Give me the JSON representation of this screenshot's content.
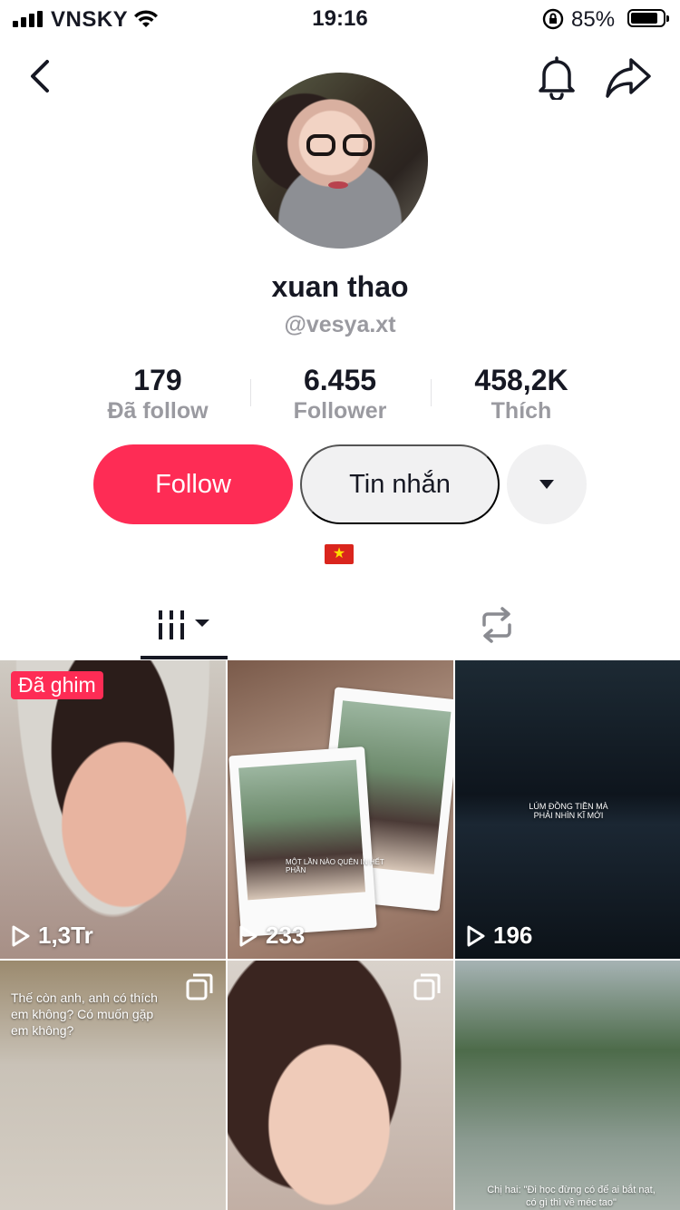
{
  "status_bar": {
    "carrier": "VNSKY",
    "time": "19:16",
    "battery_percent": "85%",
    "battery_level": 0.85
  },
  "header": {
    "back_icon": "chevron-left-icon",
    "notification_icon": "bell-icon",
    "share_icon": "share-arrow-icon"
  },
  "profile": {
    "display_name": "xuan thao",
    "username": "@vesya.xt",
    "stats": [
      {
        "value": "179",
        "label": "Đã follow"
      },
      {
        "value": "6.455",
        "label": "Follower"
      },
      {
        "value": "458,2K",
        "label": "Thích"
      }
    ],
    "bio_flag": "vietnam-flag-icon"
  },
  "actions": {
    "follow_label": "Follow",
    "message_label": "Tin nhắn",
    "more_icon": "caret-down-icon"
  },
  "tabs": [
    {
      "name": "videos",
      "icon": "grid-videos-icon",
      "active": true
    },
    {
      "name": "reposts",
      "icon": "repost-icon",
      "active": false
    }
  ],
  "videos": [
    {
      "pinned_label": "Đã ghim",
      "views": "1,3Tr"
    },
    {
      "views": "233",
      "overlay": "MỘT LẦN NÀO QUÊN IN HẾT PHẦN"
    },
    {
      "views": "196",
      "overlay": "LÚM ĐỒNG TIỀN MÀ PHẢI NHÌN KĨ MỚI"
    },
    {
      "overlay": "Thế còn anh, anh có thích em không? Có muốn gặp em không?"
    },
    {},
    {
      "overlay": "Chị hai: \"Đi học đừng có để ai bắt nạt, có gì thì về méc tao\""
    }
  ],
  "colors": {
    "accent": "#fe2c55",
    "secondary_button": "#f1f1f2",
    "muted_text": "#9a9aa0"
  }
}
